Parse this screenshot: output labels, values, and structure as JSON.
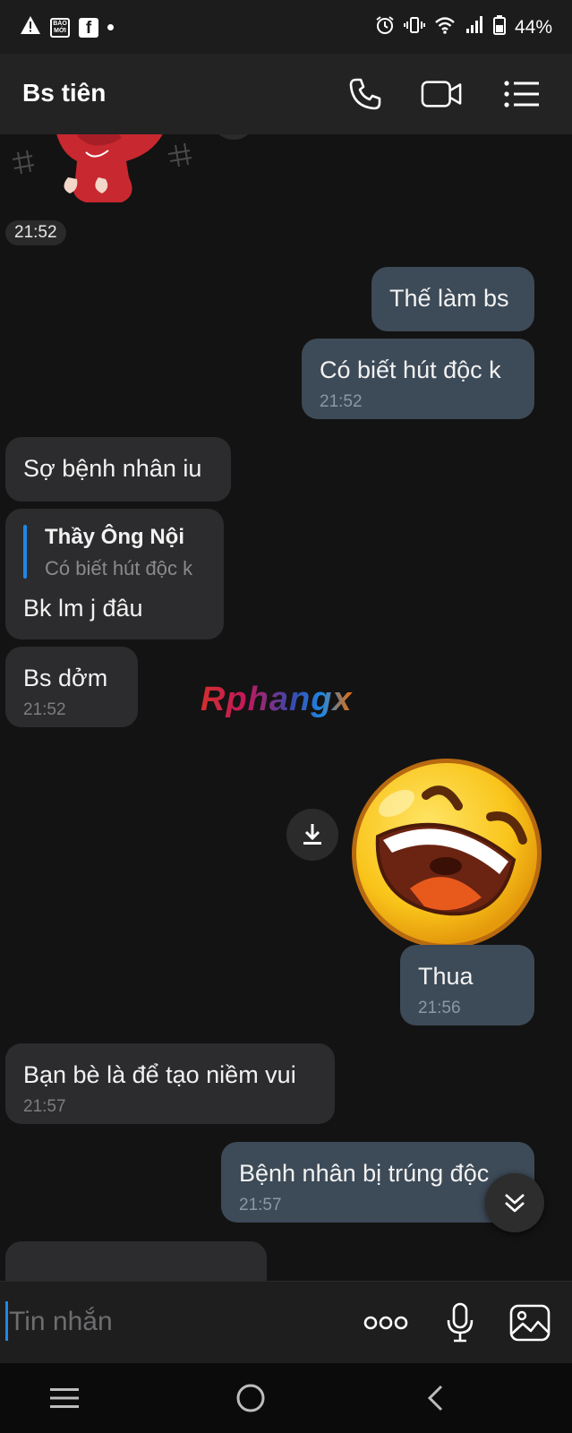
{
  "status_bar": {
    "baomoi_label": "BÁO MỚI",
    "fb_label": "f",
    "battery": "44%"
  },
  "header": {
    "title": "Bs tiên"
  },
  "chat": {
    "sticker_time": "21:52",
    "messages": [
      {
        "text": "Thế làm bs"
      },
      {
        "text": "Có biết hút độc k",
        "time": "21:52"
      },
      {
        "text": "Sợ bệnh nhân iu"
      },
      {
        "reply_name": "Thầy Ông Nội",
        "reply_text": "Có biết hút độc k",
        "text": "Bk lm j đâu"
      },
      {
        "text": "Bs dởm",
        "time": "21:52"
      },
      {
        "text": "Thua",
        "time": "21:56"
      },
      {
        "text": "Bạn bè là để tạo niềm vui",
        "time": "21:57"
      },
      {
        "text": "Bệnh nhân bị trúng độc",
        "time": "21:57"
      }
    ],
    "watermark": "Rphangx"
  },
  "input": {
    "placeholder": "Tin nhắn"
  },
  "colors": {
    "outgoing_bubble": "#3d4a57",
    "incoming_bubble": "#2c2c2e",
    "accent": "#1e88e5"
  }
}
